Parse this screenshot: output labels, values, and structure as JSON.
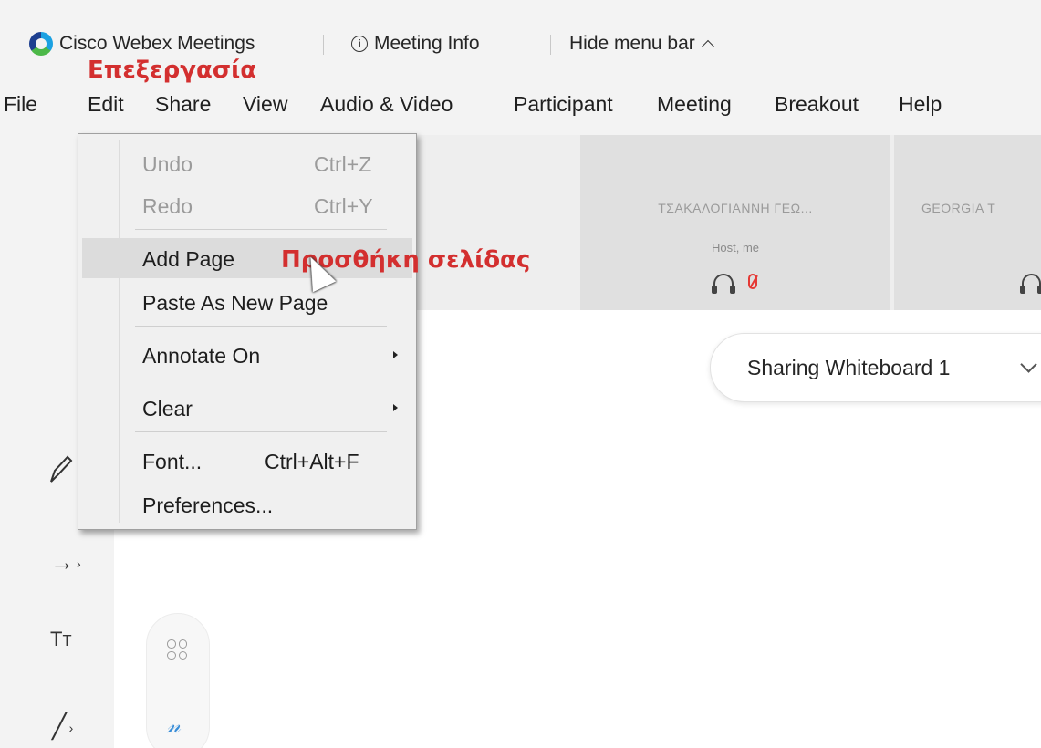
{
  "titlebar": {
    "app_name": "Cisco Webex Meetings",
    "meeting_info": "Meeting Info",
    "hide_menu": "Hide menu bar"
  },
  "annotations": {
    "edit_translation": "Επεξεργασία",
    "add_page_translation": "Προσθήκη σελίδας"
  },
  "menubar": {
    "items": [
      "File",
      "Edit",
      "Share",
      "View",
      "Audio & Video",
      "Participant",
      "Meeting",
      "Breakout",
      "Help"
    ]
  },
  "edit_menu": {
    "undo": {
      "label": "Undo",
      "shortcut": "Ctrl+Z"
    },
    "redo": {
      "label": "Redo",
      "shortcut": "Ctrl+Y"
    },
    "add_page": {
      "label": "Add Page"
    },
    "paste_new_page": {
      "label": "Paste As New Page"
    },
    "annotate_on": {
      "label": "Annotate On"
    },
    "clear": {
      "label": "Clear"
    },
    "font": {
      "label": "Font...",
      "shortcut": "Ctrl+Alt+F"
    },
    "preferences": {
      "label": "Preferences..."
    }
  },
  "participants": [
    {
      "name": "ΤΣΑΚΑΛΟΓΙΑΝΝΗ ΓΕΩ...",
      "role": "Host, me"
    },
    {
      "name": "GEORGIA T"
    }
  ],
  "sharing": {
    "label": "Sharing Whiteboard 1"
  },
  "tools": {
    "text_tool": "Tт"
  },
  "colors": {
    "accent_red": "#d32f2f",
    "webex_blue": "#1ba1e2",
    "webex_green": "#4cb848"
  }
}
